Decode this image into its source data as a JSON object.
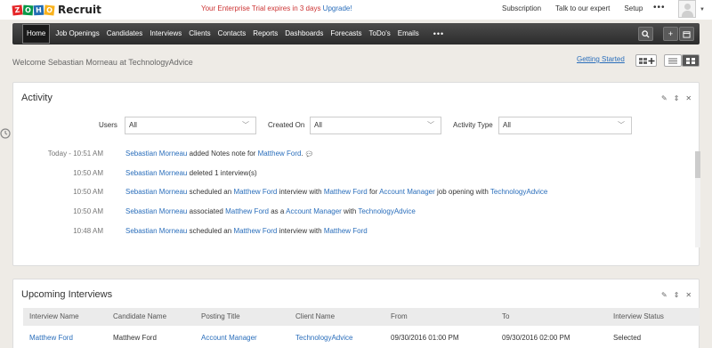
{
  "brand": {
    "logo_letters": [
      "Z",
      "O",
      "H",
      "O"
    ],
    "logo_colors": [
      "#e42527",
      "#089949",
      "#226db4",
      "#f9b21d"
    ],
    "app_name": "Recruit"
  },
  "header": {
    "trial_text": "Your Enterprise Trial expires in 3 days",
    "upgrade_label": "Upgrade!",
    "links": [
      "Subscription",
      "Talk to our expert",
      "Setup"
    ],
    "more_icon": "•••"
  },
  "nav": {
    "items": [
      "Home",
      "Job Openings",
      "Candidates",
      "Interviews",
      "Clients",
      "Contacts",
      "Reports",
      "Dashboards",
      "Forecasts",
      "ToDo's",
      "Emails"
    ],
    "more": "•••",
    "active_index": 0
  },
  "welcome": "Welcome Sebastian Morneau at TechnologyAdvice",
  "getting_started": "Getting Started",
  "activity": {
    "title": "Activity",
    "filters": {
      "users_label": "Users",
      "users_value": "All",
      "created_label": "Created On",
      "created_value": "All",
      "type_label": "Activity Type",
      "type_value": "All"
    },
    "rows": [
      {
        "time": "Today - 10:51 AM",
        "parts": [
          {
            "t": "Sebastian Morneau",
            "link": true
          },
          {
            "t": " added Notes note for ",
            "link": false
          },
          {
            "t": "Matthew Ford",
            "link": true
          },
          {
            "t": ".",
            "link": false
          }
        ],
        "note_icon": true
      },
      {
        "time": "10:50 AM",
        "parts": [
          {
            "t": "Sebastian Morneau",
            "link": true
          },
          {
            "t": " deleted 1 interview(s)",
            "link": false
          }
        ]
      },
      {
        "time": "10:50 AM",
        "parts": [
          {
            "t": "Sebastian Morneau",
            "link": true
          },
          {
            "t": " scheduled an ",
            "link": false
          },
          {
            "t": "Matthew Ford",
            "link": true
          },
          {
            "t": " interview with ",
            "link": false
          },
          {
            "t": "Matthew Ford",
            "link": true
          },
          {
            "t": " for ",
            "link": false
          },
          {
            "t": "Account Manager",
            "link": true
          },
          {
            "t": " job opening with ",
            "link": false
          },
          {
            "t": "TechnologyAdvice",
            "link": true
          }
        ]
      },
      {
        "time": "10:50 AM",
        "parts": [
          {
            "t": "Sebastian Morneau",
            "link": true
          },
          {
            "t": " associated ",
            "link": false
          },
          {
            "t": "Matthew Ford",
            "link": true
          },
          {
            "t": " as a ",
            "link": false
          },
          {
            "t": "Account Manager",
            "link": true
          },
          {
            "t": " with ",
            "link": false
          },
          {
            "t": "TechnologyAdvice",
            "link": true
          }
        ]
      },
      {
        "time": "10:48 AM",
        "parts": [
          {
            "t": "Sebastian Morneau",
            "link": true
          },
          {
            "t": " scheduled an ",
            "link": false
          },
          {
            "t": "Matthew Ford",
            "link": true
          },
          {
            "t": " interview with ",
            "link": false
          },
          {
            "t": "Matthew Ford",
            "link": true
          }
        ]
      }
    ]
  },
  "interviews": {
    "title": "Upcoming Interviews",
    "columns": [
      "Interview Name",
      "Candidate Name",
      "Posting Title",
      "Client Name",
      "From",
      "To",
      "Interview Status"
    ],
    "rows": [
      [
        "Matthew Ford",
        "Matthew Ford",
        "Account Manager",
        "TechnologyAdvice",
        "09/30/2016 01:00 PM",
        "09/30/2016 02:00 PM",
        "Selected"
      ]
    ]
  },
  "colors": {
    "link": "#2a6ebb",
    "trial": "#cc3333",
    "nav_dark": "#2c2c2c",
    "background": "#eeebe6"
  }
}
